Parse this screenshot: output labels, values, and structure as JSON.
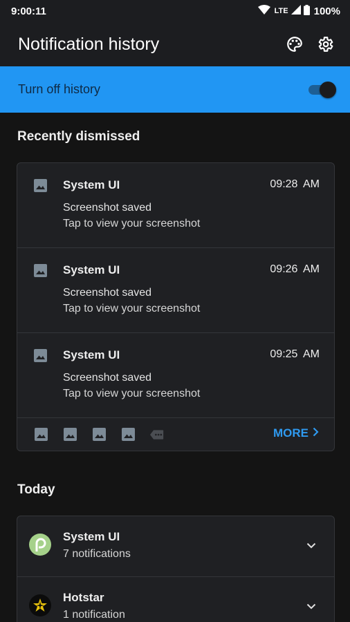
{
  "status_bar": {
    "time": "9:00:11",
    "network": "LTE",
    "battery": "100%"
  },
  "app_bar": {
    "title": "Notification history",
    "palette_icon": "palette-icon",
    "settings_icon": "gear-icon"
  },
  "history_toggle": {
    "label": "Turn off history",
    "on": true
  },
  "recently_dismissed": {
    "heading": "Recently dismissed",
    "items": [
      {
        "app": "System UI",
        "time": "09:28 AM",
        "title": "Screenshot saved",
        "text": "Tap to view your screenshot"
      },
      {
        "app": "System UI",
        "time": "09:26 AM",
        "title": "Screenshot saved",
        "text": "Tap to view your screenshot"
      },
      {
        "app": "System UI",
        "time": "09:25 AM",
        "title": "Screenshot saved",
        "text": "Tap to view your screenshot"
      }
    ],
    "more_label": "MORE"
  },
  "today": {
    "heading": "Today",
    "groups": [
      {
        "app": "System UI",
        "count": "7 notifications"
      },
      {
        "app": "Hotstar",
        "count": "1 notification"
      }
    ]
  },
  "colors": {
    "accent": "#2196f3",
    "background": "#141414",
    "card": "#1f2023",
    "more": "#2f9af0"
  }
}
